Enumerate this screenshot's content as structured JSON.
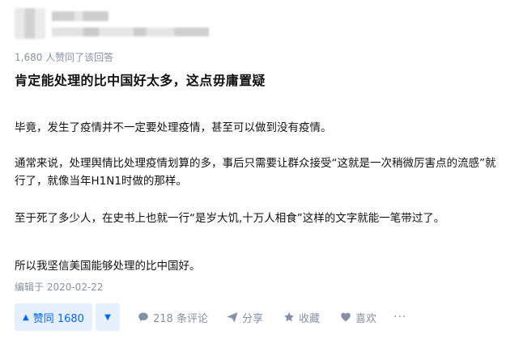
{
  "answer": {
    "upvote_count_text": "1,680 人赞同了该回答",
    "title": "肯定能处理的比中国好太多，这点毋庸置疑",
    "paragraphs": [
      "毕竟，发生了疫情并不一定要处理疫情，甚至可以做到没有疫情。",
      "通常来说，处理舆情比处理疫情划算的多，事后只需要让群众接受“这就是一次稍微厉害点的流感”就行了，就像当年H1N1时做的那样。",
      "至于死了多少人，在史书上也就一行“是岁大饥,十万人相食”这样的文字就能一笔带过了。",
      "所以我坚信美国能够处理的比中国好。"
    ],
    "edited": "编辑于 2020-02-22"
  },
  "actions": {
    "upvote_label": "赞同 1680",
    "comment_label": "218 条评论",
    "share_label": "分享",
    "favorite_label": "收藏",
    "like_label": "喜欢",
    "more_label": "···"
  },
  "colors": {
    "accent": "#0066ff",
    "accent_bg": "#e5effd",
    "meta": "#8590a6",
    "text": "#121212"
  }
}
